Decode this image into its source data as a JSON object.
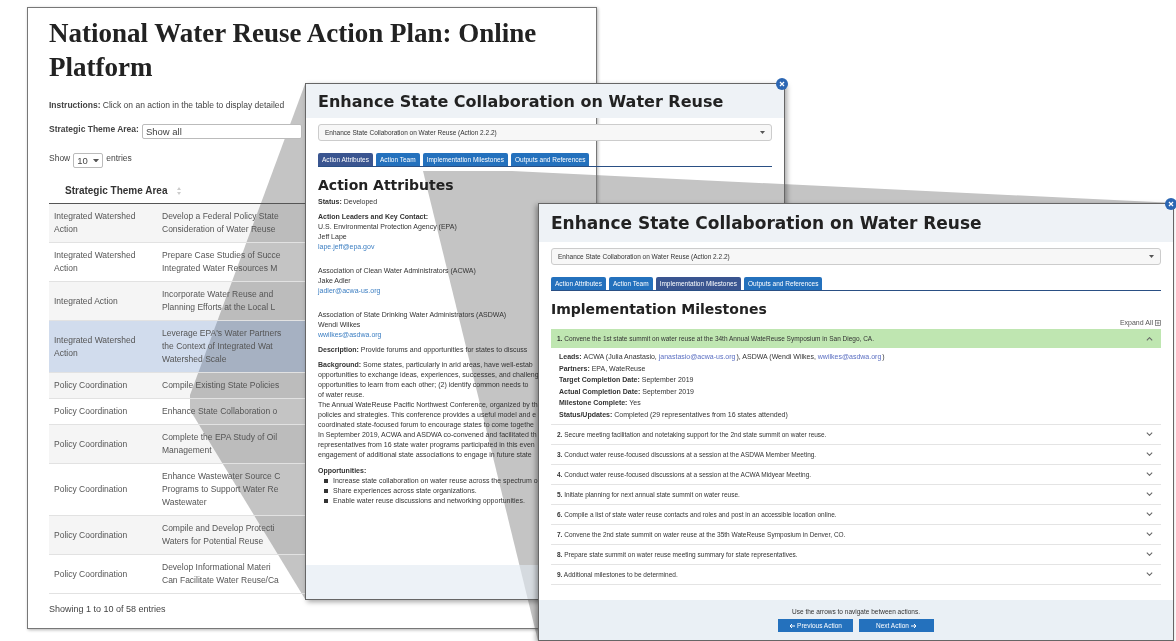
{
  "main_page": {
    "title": "National Water Reuse Action Plan: Online Platform",
    "instructions": "**Instructions:** Click on an action in the table to display detailed",
    "filter_label": "Strategic Theme Area:",
    "filter_value": "Show all",
    "length_show": "Show",
    "length_value": "10",
    "length_entries": "entries",
    "table": {
      "columns": [
        "Strategic Theme Area"
      ],
      "rows": [
        {
          "theme": "Integrated Watershed Action",
          "action_lines": [
            "Develop a Federal Policy State",
            "Consideration of Water Reuse"
          ],
          "selected": false
        },
        {
          "theme": "Integrated Watershed Action",
          "action_lines": [
            "Prepare Case Studies of Succe",
            "Integrated Water Resources M"
          ],
          "selected": false
        },
        {
          "theme": "Integrated Action",
          "action_lines": [
            "Incorporate Water Reuse and",
            "Planning Efforts at the Local L"
          ],
          "selected": false
        },
        {
          "theme": "Integrated Watershed Action",
          "action_lines": [
            "Leverage EPA's Water Partners",
            "the Context of Integrated Wat",
            "Watershed Scale"
          ],
          "selected": true
        },
        {
          "theme": "Policy Coordination",
          "action_lines": [
            "Compile Existing State Policies"
          ],
          "selected": false
        },
        {
          "theme": "Policy Coordination",
          "action_lines": [
            "Enhance State Collaboration o"
          ],
          "selected": false
        },
        {
          "theme": "Policy Coordination",
          "action_lines": [
            "Complete the EPA Study of Oil",
            "Management"
          ],
          "selected": false
        },
        {
          "theme": "Policy Coordination",
          "action_lines": [
            "Enhance Wastewater Source C",
            "Programs to Support Water Re",
            "Wastewater"
          ],
          "selected": false
        },
        {
          "theme": "Policy Coordination",
          "action_lines": [
            "Compile and Develop Protecti",
            "Waters for Potential Reuse"
          ],
          "selected": false
        },
        {
          "theme": "Policy Coordination",
          "action_lines": [
            "Develop Informational Materi",
            "Can Facilitate Water Reuse/Ca"
          ],
          "selected": false
        }
      ]
    },
    "info": "Showing 1 to 10 of 58 entries"
  },
  "attributes_window": {
    "title": "Enhance State Collaboration on Water Reuse",
    "action_select": "Enhance State Collaboration on Water Reuse (Action 2.2.2)",
    "tabs": [
      {
        "label": "Action Attributes",
        "selected": true
      },
      {
        "label": "Action Team",
        "selected": false
      },
      {
        "label": "Implementation Milestones",
        "selected": false
      },
      {
        "label": "Outputs and References",
        "selected": false
      }
    ],
    "heading": "Action Attributes",
    "status": "**Status:** Developed",
    "contacts_label": "Action Leaders and Key Contact:",
    "contacts": [
      {
        "org": "U.S. Environmental Protection Agency (EPA)",
        "name": "Jeff Lape",
        "email": "lape.jeff@epa.gov"
      },
      {
        "org": "Association of Clean Water Administrators (ACWA)",
        "name": "Jake Adler",
        "email": "jadler@acwa-us.org"
      },
      {
        "org": "Association of State Drinking Water Administrators (ASDWA)",
        "name": "Wendi Wilkes",
        "email": "wwilkes@asdwa.org"
      }
    ],
    "description": "**Description:** Provide forums and opportunities for states to discuss",
    "background_lines": [
      "**Background:** Some states, particularly in arid areas, have well-estab",
      "opportunities to exchange ideas, experiences, successes, and challeng",
      "opportunities to learn from each other; (2) identify common needs to",
      "of water reuse.",
      "The Annual WateReuse Pacific Northwest Conference, organized by th",
      "policies and strategies. This conference provides a useful model and e",
      "coordinated state-focused forum to encourage states to come togethe",
      "In September 2019, ACWA and ASDWA co-convened and facilitated th",
      "representatives from 16 state water programs participated in this even",
      "engagement of additional state associations to engage in future state"
    ],
    "opportunities_label": "Opportunities:",
    "opportunities": [
      "Increase state collaboration on water reuse across the spectrum o",
      "Share experiences across state organizations.",
      "Enable water reuse discussions and networking opportunities."
    ]
  },
  "milestones_window": {
    "title": "Enhance State Collaboration on Water Reuse",
    "action_select": "Enhance State Collaboration on Water Reuse (Action 2.2.2)",
    "tabs": [
      {
        "label": "Action Attributes",
        "selected": false
      },
      {
        "label": "Action Team",
        "selected": false
      },
      {
        "label": "Implementation Milestones",
        "selected": true
      },
      {
        "label": "Outputs and References",
        "selected": false
      }
    ],
    "heading": "Implementation Milestones",
    "expand_all": "Expand All",
    "milestones": [
      {
        "text": "**1.** Convene the 1st state summit on water reuse at the 34th Annual WateReuse Symposium in San Diego, CA.",
        "expanded": true,
        "details": [
          {
            "kind": "parts",
            "label": "Leads:",
            "parts": [
              {
                "text": "ACWA (Julia Anastasio, ",
                "link": false
              },
              {
                "text": "janastasio@acwa-us.org",
                "link": true
              },
              {
                "text": "), ASDWA (Wendi Wilkes, ",
                "link": false
              },
              {
                "text": "wwilkes@asdwa.org",
                "link": true
              },
              {
                "text": ")",
                "link": false
              }
            ]
          },
          {
            "kind": "line",
            "text": "**Partners:** EPA, WateReuse"
          },
          {
            "kind": "line",
            "text": "**Target Completion Date:** September 2019"
          },
          {
            "kind": "line",
            "text": "**Actual Completion Date:** September 2019"
          },
          {
            "kind": "line",
            "text": "**Milestone Complete:** Yes"
          },
          {
            "kind": "line",
            "text": "**Status/Updates:** Completed (29 representatives from 16 states attended)"
          }
        ]
      },
      {
        "text": "**2.** Secure meeting facilitation and notetaking support for the 2nd state summit on water reuse.",
        "expanded": false
      },
      {
        "text": "**3.** Conduct water reuse-focused discussions at a session at the ASDWA Member Meeting.",
        "expanded": false
      },
      {
        "text": "**4.** Conduct water reuse-focused discussions at a session at the ACWA Midyear Meeting.",
        "expanded": false
      },
      {
        "text": "**5.** Initiate planning for next annual state summit on water reuse.",
        "expanded": false
      },
      {
        "text": "**6.** Compile a list of state water reuse contacts and roles and post in an accessible location online.",
        "expanded": false
      },
      {
        "text": "**7.** Convene the 2nd state summit on water reuse at the 35th WateReuse Symposium in Denver, CO.",
        "expanded": false
      },
      {
        "text": "**8.** Prepare state summit on water reuse meeting summary for state representatives.",
        "expanded": false
      },
      {
        "text": "**9.** Additional milestones to be determined.",
        "expanded": false
      }
    ],
    "nav_hint": "Use the arrows to navigate between actions.",
    "prev_button": "Previous Action",
    "next_button": "Next Action"
  }
}
